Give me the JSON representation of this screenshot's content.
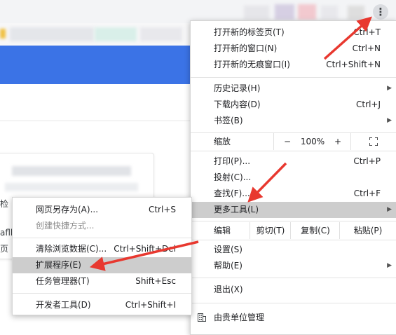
{
  "main_menu": {
    "items_top": [
      {
        "label": "打开新的标签页(T)",
        "shortcut": "Ctrl+T"
      },
      {
        "label": "打开新的窗口(N)",
        "shortcut": "Ctrl+N"
      },
      {
        "label": "打开新的无痕窗口(I)",
        "shortcut": "Ctrl+Shift+N"
      }
    ],
    "history": {
      "label": "历史记录(H)"
    },
    "downloads": {
      "label": "下载内容(D)",
      "shortcut": "Ctrl+J"
    },
    "bookmarks": {
      "label": "书签(B)"
    },
    "zoom": {
      "label": "缩放",
      "minus": "−",
      "value": "100%",
      "plus": "+"
    },
    "print": {
      "label": "打印(P)...",
      "shortcut": "Ctrl+P"
    },
    "cast": {
      "label": "投射(C)..."
    },
    "find": {
      "label": "查找(F)...",
      "shortcut": "Ctrl+F"
    },
    "more_tools": {
      "label": "更多工具(L)"
    },
    "edit": {
      "label": "编辑",
      "cut": "剪切(T)",
      "copy": "复制(C)",
      "paste": "粘贴(P)"
    },
    "settings": {
      "label": "设置(S)"
    },
    "help": {
      "label": "帮助(E)"
    },
    "exit": {
      "label": "退出(X)"
    },
    "managed": {
      "label": "由贵单位管理"
    }
  },
  "sub_menu": {
    "save_page": {
      "label": "网页另存为(A)...",
      "shortcut": "Ctrl+S"
    },
    "create_shortcut": {
      "label": "创建快捷方式..."
    },
    "clear_data": {
      "label": "清除浏览数据(C)...",
      "shortcut": "Ctrl+Shift+Del"
    },
    "extensions": {
      "label": "扩展程序(E)"
    },
    "task_manager": {
      "label": "任务管理器(T)",
      "shortcut": "Shift+Esc"
    },
    "dev_tools": {
      "label": "开发者工具(D)",
      "shortcut": "Ctrl+Shift+I"
    }
  },
  "background_fragments": {
    "frag1": "检",
    "frag2": "aflk",
    "frag3": "页"
  },
  "colors": {
    "annotation_arrow": "#e8382f",
    "highlight": "#cdcdcd",
    "brand_bar": "#3b73e6"
  },
  "icons": [
    "more-vert-icon",
    "fullscreen-icon",
    "building-icon",
    "submenu-arrow-icon"
  ]
}
